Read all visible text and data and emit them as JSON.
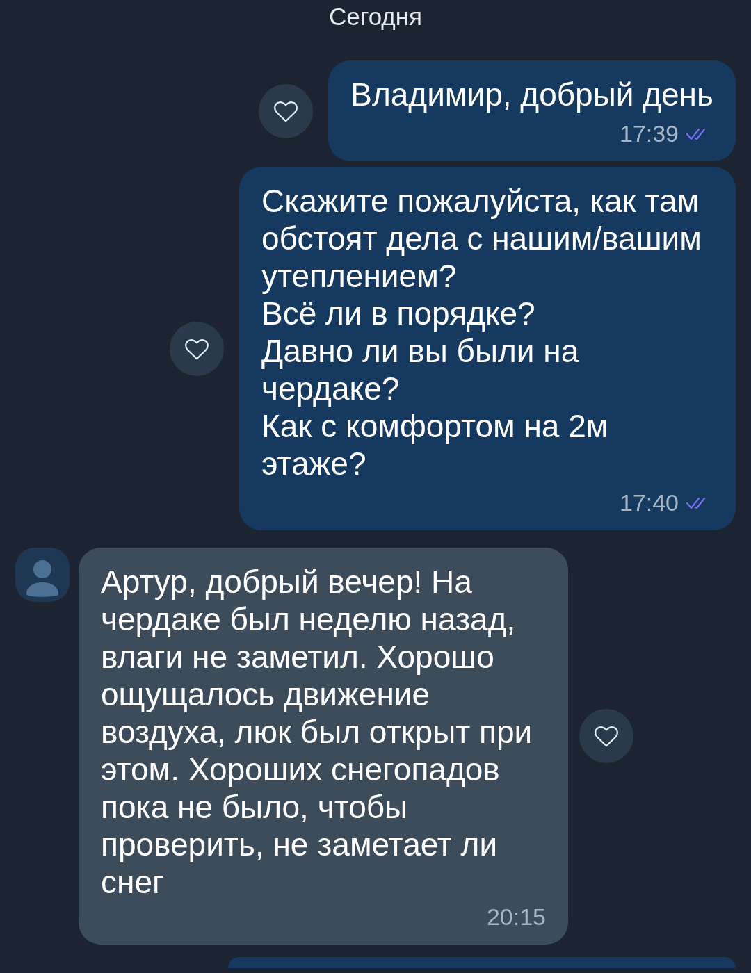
{
  "date_label": "Сегодня",
  "messages": [
    {
      "kind": "outgoing",
      "text": "Владимир, добрый день",
      "time": "17:39",
      "read": true
    },
    {
      "kind": "outgoing",
      "text": "Скажите пожалуйста, как там обстоят дела с нашим/вашим утеплением?\nВсё ли в порядке?\nДавно ли вы были на чердаке?\nКак с комфортом на 2м этаже?",
      "time": "17:40",
      "read": true
    },
    {
      "kind": "incoming",
      "text": "Артур, добрый вечер! На чердаке был неделю назад, влаги не заметил. Хорошо ощущалось движение воздуха, люк был открыт при этом. Хороших снегопадов пока не было, чтобы проверить, не заметает ли снег",
      "time": "20:15"
    },
    {
      "kind": "outgoing"
    }
  ]
}
